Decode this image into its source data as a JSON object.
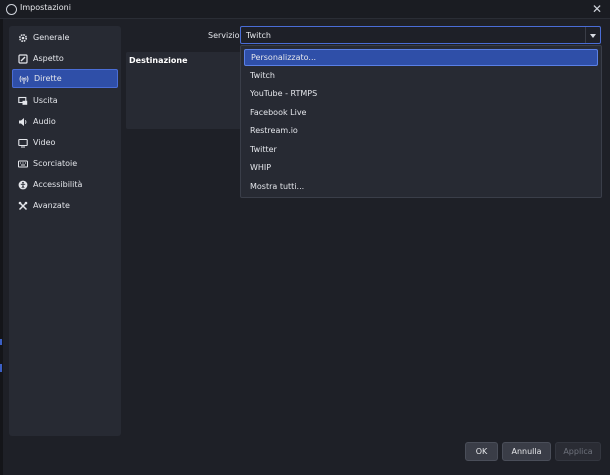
{
  "window": {
    "title": "Impostazioni",
    "close_glyph": "✕"
  },
  "sidebar": {
    "items": [
      {
        "label": "Generale",
        "icon": "gear-icon",
        "active": false
      },
      {
        "label": "Aspetto",
        "icon": "appearance-icon",
        "active": false
      },
      {
        "label": "Dirette",
        "icon": "antenna-icon",
        "active": true
      },
      {
        "label": "Uscita",
        "icon": "output-icon",
        "active": false
      },
      {
        "label": "Audio",
        "icon": "speaker-icon",
        "active": false
      },
      {
        "label": "Video",
        "icon": "monitor-icon",
        "active": false
      },
      {
        "label": "Scorciatoie",
        "icon": "keyboard-icon",
        "active": false
      },
      {
        "label": "Accessibilità",
        "icon": "accessibility-icon",
        "active": false
      },
      {
        "label": "Avanzate",
        "icon": "tools-icon",
        "active": false
      }
    ]
  },
  "stream": {
    "service_label": "Servizio",
    "service_value": "Twitch",
    "destination_title": "Destinazione",
    "options": [
      {
        "label": "Personalizzato...",
        "selected": true
      },
      {
        "label": "Twitch",
        "selected": false
      },
      {
        "label": "YouTube - RTMPS",
        "selected": false
      },
      {
        "label": "Facebook Live",
        "selected": false
      },
      {
        "label": "Restream.io",
        "selected": false
      },
      {
        "label": "Twitter",
        "selected": false
      },
      {
        "label": "WHIP",
        "selected": false
      },
      {
        "label": "Mostra tutti...",
        "selected": false
      }
    ]
  },
  "footer": {
    "ok": "OK",
    "cancel": "Annulla",
    "apply": "Applica"
  },
  "colors": {
    "background": "#1e2027",
    "panel": "#272a33",
    "accent": "#2f4fa8",
    "accent_border": "#4a6dd6"
  }
}
